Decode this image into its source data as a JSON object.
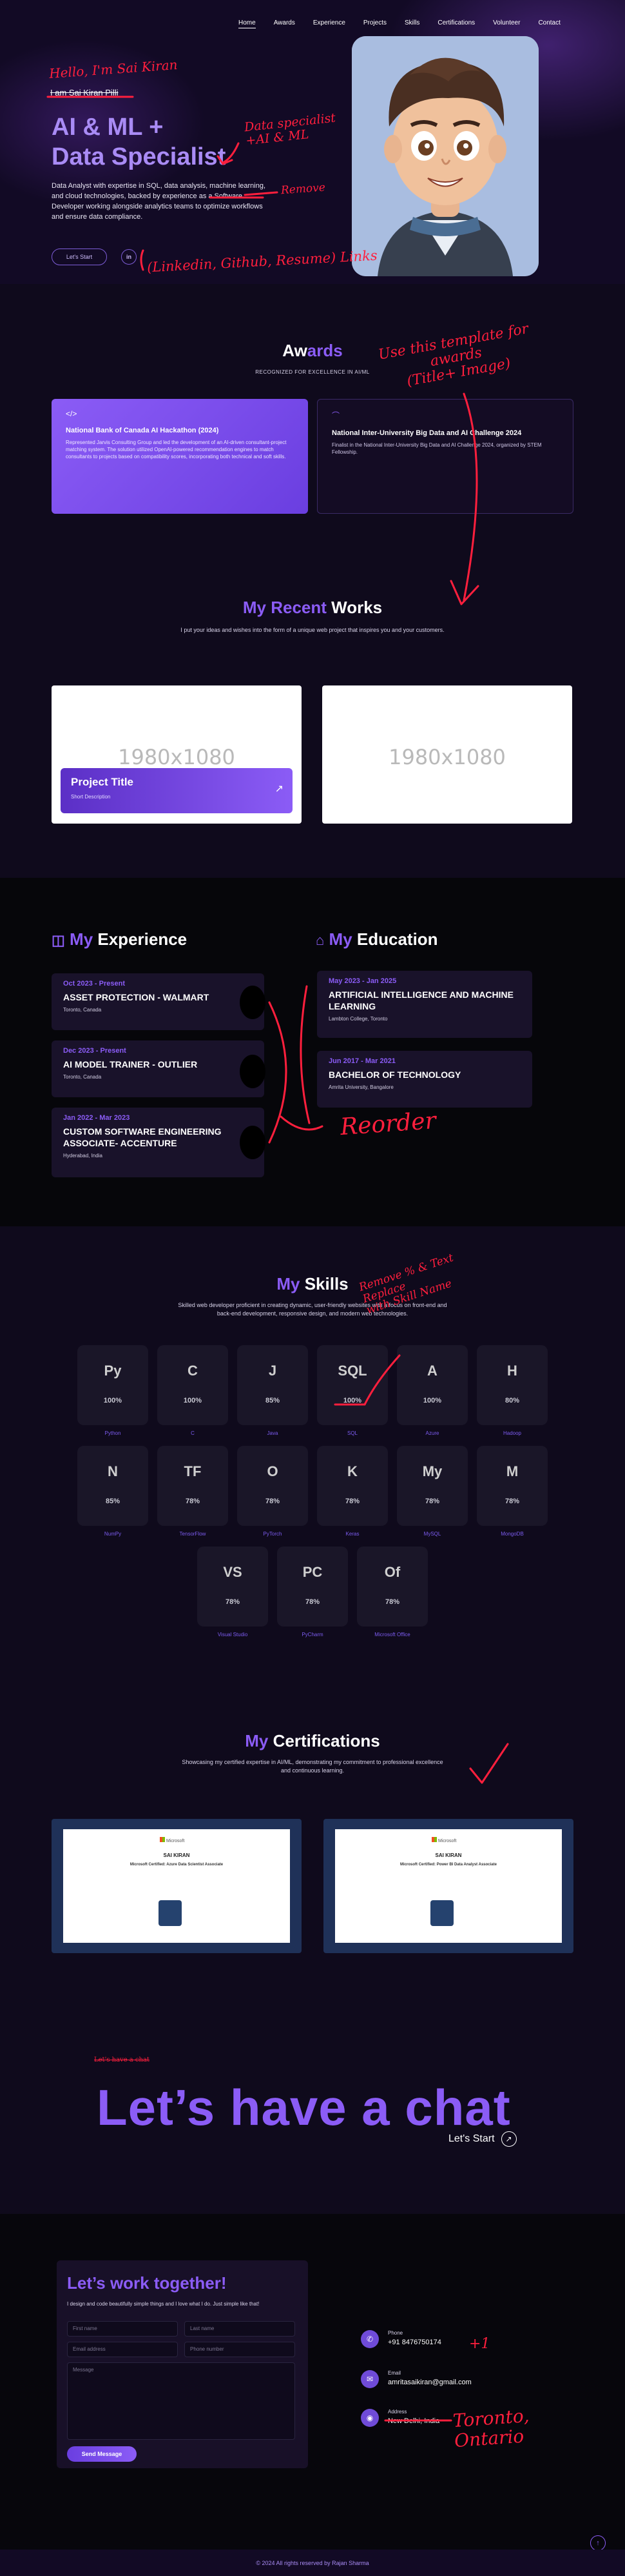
{
  "nav": [
    "Home",
    "Awards",
    "Experience",
    "Projects",
    "Skills",
    "Certifications",
    "Volunteer",
    "Contact"
  ],
  "hero": {
    "greeting": "I am Sai Kiran Pilli",
    "title_line1": "AI & ML +",
    "title_line2": "Data Specialist",
    "description": "Data Analyst with expertise in SQL, data analysis, machine learning, and cloud technologies, backed by experience as a Software Developer working alongside analytics teams to optimize workflows and ensure data compliance.",
    "cta": "Let's Start",
    "linkedin": "in"
  },
  "annotations": {
    "hello": "Hello, I'm Sai Kiran",
    "data_specialist": "Data specialist\n+AI & ML",
    "remove": "Remove",
    "links": "(Linkedin, Github, Resume) Links",
    "template_awards": "Use this template for\nawards\n(Title+ Image)",
    "reorder": "Reorder",
    "skills_note": "Remove % & Text\nReplace\nwith Skill Name",
    "toronto": "Toronto,\nOntario",
    "plus1": "+1"
  },
  "awards": {
    "title_white": "Aw",
    "title_purple": "ards",
    "subtitle": "RECOGNIZED FOR EXCELLENCE IN AI/ML",
    "items": [
      {
        "title": "National Bank of Canada AI Hackathon (2024)",
        "desc": "Represented Jarvis Consulting Group and led the development of an AI-driven consultant-project matching system. The solution utilized OpenAI-powered recommendation engines to match consultants to projects based on compatibility scores, incorporating both technical and soft skills."
      },
      {
        "title": "National Inter-University Big Data and AI Challenge 2024",
        "desc": "Finalist in the National Inter-University Big Data and AI Challenge 2024, organized by STEM Fellowship."
      }
    ]
  },
  "works": {
    "title_purple": "My Recent",
    "title_white": " Works",
    "subtitle": "I put your ideas and wishes into the form of a unique web project that inspires you and your customers.",
    "placeholder": "1980x1080",
    "project_title": "Project Title",
    "project_desc": "Short Description"
  },
  "experience": {
    "title_purple": "My",
    "title_white": " Experience",
    "items": [
      {
        "date": "Oct 2023 - Present",
        "role": "ASSET PROTECTION - WALMART",
        "org": "Toronto, Canada"
      },
      {
        "date": "Dec 2023 - Present",
        "role": "AI MODEL TRAINER - OUTLIER",
        "org": "Toronto, Canada"
      },
      {
        "date": "Jan 2022 - Mar 2023",
        "role": "CUSTOM SOFTWARE ENGINEERING ASSOCIATE- ACCENTURE",
        "org": "Hyderabad, India"
      }
    ]
  },
  "education": {
    "title_purple": "My",
    "title_white": " Education",
    "items": [
      {
        "date": "May 2023 - Jan 2025",
        "role": "ARTIFICIAL INTELLIGENCE AND MACHINE LEARNING",
        "org": "Lambton College, Toronto"
      },
      {
        "date": "Jun 2017 - Mar 2021",
        "role": "BACHELOR OF TECHNOLOGY",
        "org": "Amrita University, Bangalore"
      }
    ]
  },
  "skills": {
    "title_purple": "My",
    "title_white": " Skills",
    "subtitle": "Skilled web developer proficient in creating dynamic, user-friendly websites with a focus on front-end and back-end development, responsive design, and modern web technologies.",
    "items": [
      {
        "name": "Python",
        "pct": "100%",
        "icon": "Py"
      },
      {
        "name": "C",
        "pct": "100%",
        "icon": "C"
      },
      {
        "name": "Java",
        "pct": "85%",
        "icon": "J"
      },
      {
        "name": "SQL",
        "pct": "100%",
        "icon": "SQL"
      },
      {
        "name": "Azure",
        "pct": "100%",
        "icon": "A"
      },
      {
        "name": "Hadoop",
        "pct": "80%",
        "icon": "H"
      },
      {
        "name": "NumPy",
        "pct": "85%",
        "icon": "N"
      },
      {
        "name": "TensorFlow",
        "pct": "78%",
        "icon": "TF"
      },
      {
        "name": "PyTorch",
        "pct": "78%",
        "icon": "O"
      },
      {
        "name": "Keras",
        "pct": "78%",
        "icon": "K"
      },
      {
        "name": "MySQL",
        "pct": "78%",
        "icon": "My"
      },
      {
        "name": "MongoDB",
        "pct": "78%",
        "icon": "M"
      },
      {
        "name": "Visual Studio",
        "pct": "78%",
        "icon": "VS"
      },
      {
        "name": "PyCharm",
        "pct": "78%",
        "icon": "PC"
      },
      {
        "name": "Microsoft Office",
        "pct": "78%",
        "icon": "Of"
      }
    ]
  },
  "certifications": {
    "title_purple": "My",
    "title_white": " Certifications",
    "subtitle": "Showcasing my certified expertise in AI/ML, demonstrating my commitment to professional excellence and continuous learning.",
    "cert1": "Microsoft Certified: Azure Data Scientist Associate",
    "cert2": "Microsoft Certified: Power BI Data Analyst Associate",
    "name": "SAI KIRAN"
  },
  "chat": {
    "heading": "Let’s have a chat",
    "cta": "Let's Start",
    "strike_note": "Let's have a chat"
  },
  "contact": {
    "title": "Let’s work together!",
    "subtitle": "I design and code beautifully simple things and I love what I do. Just simple like that!",
    "fields": {
      "first": "First name",
      "last": "Last name",
      "email": "Email address",
      "phone": "Phone number",
      "message": "Message"
    },
    "send": "Send Message",
    "phone_label": "Phone",
    "phone_value": "+91 8476750174",
    "email_label": "Email",
    "email_value": "amritasaikiran@gmail.com",
    "address_label": "Address",
    "address_value": "New Delhi, India"
  },
  "footer": "© 2024 All rights reserved by Rajan Sharma"
}
